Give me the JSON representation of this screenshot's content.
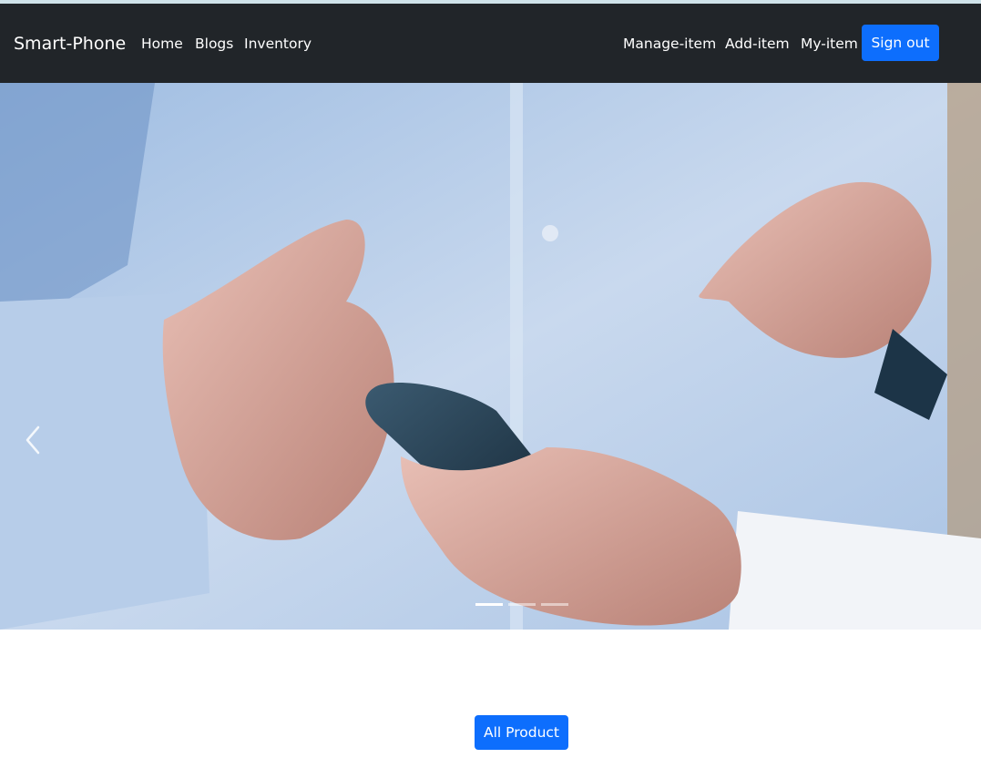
{
  "navbar": {
    "brand": "Smart-Phone",
    "left_links": [
      "Home",
      "Blogs",
      "Inventory"
    ],
    "right_links": [
      "Manage-item",
      "Add-item",
      "My-item"
    ],
    "signout_label": "Sign out"
  },
  "carousel": {
    "slide_count": 3,
    "active_index": 0,
    "prev_icon": "chevron-left-icon"
  },
  "main": {
    "all_product_label": "All Product"
  },
  "colors": {
    "navbar_bg": "#212529",
    "primary": "#0d6efd"
  }
}
